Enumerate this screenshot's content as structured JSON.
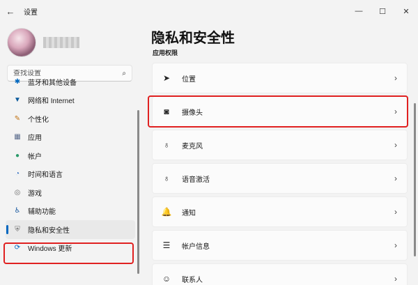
{
  "window": {
    "title": "设置",
    "back_icon": "←",
    "minimize_icon": "—",
    "maximize_icon": "☐",
    "close_icon": "✕"
  },
  "search": {
    "placeholder": "查找设置",
    "icon": "⌕"
  },
  "sidebar": {
    "items": [
      {
        "label": "蓝牙和其他设备",
        "icon": "✱",
        "color": "#0067c0"
      },
      {
        "label": "网络和 Internet",
        "icon": "▼",
        "color": "#0a5a9c"
      },
      {
        "label": "个性化",
        "icon": "✎",
        "color": "#c07010"
      },
      {
        "label": "应用",
        "icon": "▦",
        "color": "#5a6b8c"
      },
      {
        "label": "帐户",
        "icon": "●",
        "color": "#2a9a6a"
      },
      {
        "label": "时间和语言",
        "icon": "◔",
        "color": "#2a6abf"
      },
      {
        "label": "游戏",
        "icon": "◎",
        "color": "#6a6a6a"
      },
      {
        "label": "辅助功能",
        "icon": "♿",
        "color": "#1a5aa0"
      },
      {
        "label": "隐私和安全性",
        "icon": "⛨",
        "color": "#6a6a6a"
      },
      {
        "label": "Windows 更新",
        "icon": "⟳",
        "color": "#0067c0"
      }
    ]
  },
  "main": {
    "title": "隐私和安全性",
    "section": "应用权限",
    "rows": [
      {
        "label": "位置",
        "icon": "➤"
      },
      {
        "label": "摄像头",
        "icon": "◙"
      },
      {
        "label": "麦克风",
        "icon": "♁"
      },
      {
        "label": "语音激活",
        "icon": "♁"
      },
      {
        "label": "通知",
        "icon": "🔔"
      },
      {
        "label": "帐户信息",
        "icon": "☰"
      },
      {
        "label": "联系人",
        "icon": "☺"
      }
    ],
    "chevron": "›"
  },
  "colors": {
    "accent": "#0067c0",
    "highlight": "#e02020"
  }
}
